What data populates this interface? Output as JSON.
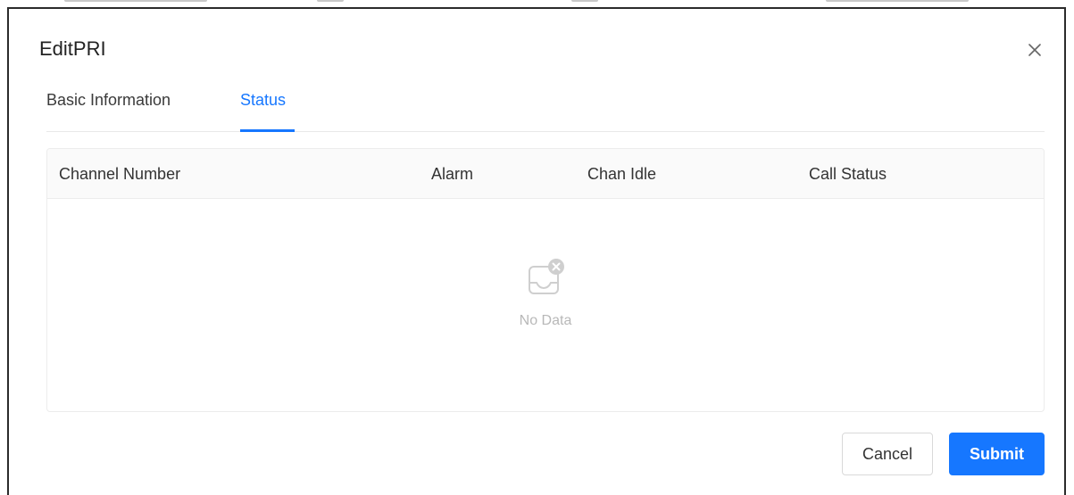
{
  "dialog": {
    "title": "EditPRI",
    "close_icon": "close-icon"
  },
  "tabs": [
    {
      "label": "Basic Information",
      "active": false
    },
    {
      "label": "Status",
      "active": true
    }
  ],
  "table": {
    "columns": [
      "Channel Number",
      "Alarm",
      "Chan Idle",
      "Call Status"
    ],
    "rows": [],
    "empty_icon": "no-data-icon",
    "empty_text": "No Data"
  },
  "footer": {
    "cancel_label": "Cancel",
    "submit_label": "Submit"
  },
  "colors": {
    "accent": "#1677ff",
    "header_bg": "#fafafa",
    "muted_text": "#b8b8b8"
  }
}
